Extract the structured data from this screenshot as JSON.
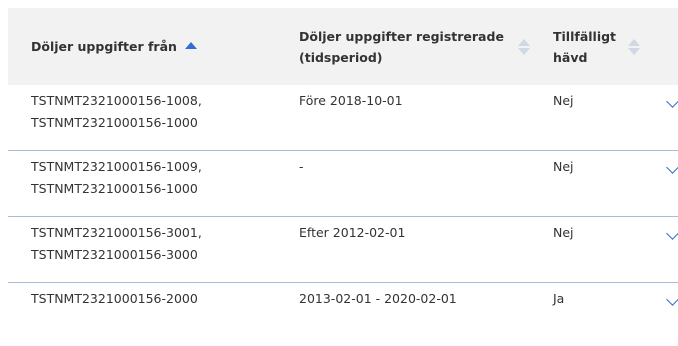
{
  "table": {
    "headers": [
      {
        "label": "Döljer uppgifter från",
        "sort": "asc"
      },
      {
        "label": "Döljer uppgifter registrerade\n(tidsperiod)",
        "sort": "none"
      },
      {
        "label": "Tillfälligt\nhävd",
        "sort": "none"
      }
    ],
    "rows": [
      {
        "from": "TSTNMT2321000156-1008,\nTSTNMT2321000156-1000",
        "period": "Före 2018-10-01",
        "temp": "Nej"
      },
      {
        "from": "TSTNMT2321000156-1009,\nTSTNMT2321000156-1000",
        "period": "-",
        "temp": "Nej"
      },
      {
        "from": "TSTNMT2321000156-3001,\nTSTNMT2321000156-3000",
        "period": "Efter 2012-02-01",
        "temp": "Nej"
      },
      {
        "from": "TSTNMT2321000156-2000",
        "period": "2013-02-01 - 2020-02-01",
        "temp": "Ja"
      }
    ]
  },
  "colors": {
    "header_bg": "#f2f2f2",
    "accent": "#2f6fd3",
    "row_border": "#a9bdd6"
  }
}
